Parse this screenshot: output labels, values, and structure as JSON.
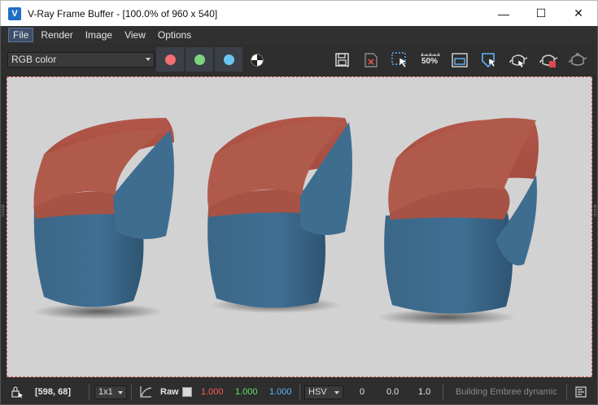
{
  "window": {
    "title": "V-Ray Frame Buffer - [100.0% of 960 x 540]",
    "app_icon": "V",
    "buttons": {
      "minimize": "—",
      "maximize": "☐",
      "close": "✕"
    }
  },
  "menu": [
    {
      "label": "File",
      "active": true
    },
    {
      "label": "Render",
      "active": false
    },
    {
      "label": "Image",
      "active": false
    },
    {
      "label": "View",
      "active": false
    },
    {
      "label": "Options",
      "active": false
    }
  ],
  "toolbar": {
    "channel": "RGB color",
    "channel_buttons": [
      {
        "name": "red-channel",
        "color": "#f46f72"
      },
      {
        "name": "green-channel",
        "color": "#7bd37f"
      },
      {
        "name": "blue-channel",
        "color": "#6cc6f1"
      }
    ],
    "zoom_badge": "50%"
  },
  "status": {
    "coords": "[598, 68]",
    "sample_size": "1x1",
    "raw_label": "Raw",
    "r": "1.000",
    "g": "1.000",
    "b": "1.000",
    "color_mode": "HSV",
    "h": "0",
    "s": "0.0",
    "v": "1.0",
    "message": "Building Embree dynamic",
    "colors": {
      "r": "#ff5b5b",
      "g": "#66e266",
      "b": "#5fb3ff"
    }
  }
}
